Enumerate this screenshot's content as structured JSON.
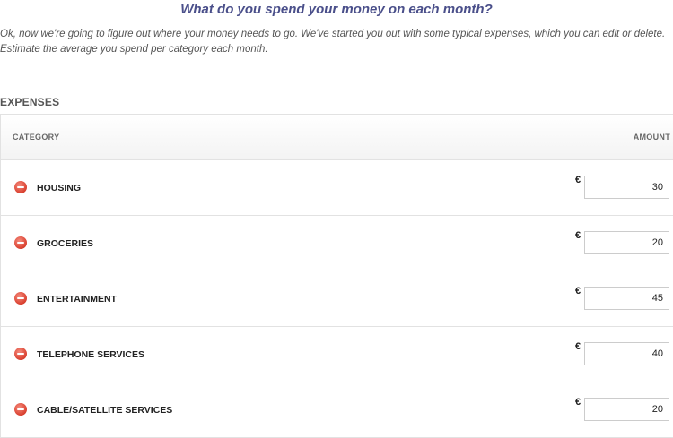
{
  "page": {
    "title": "What do you spend your money on each month?",
    "intro": "Ok, now we're going to figure out where your money needs to go. We've started you out with some typical expenses, which you can edit or delete. Estimate the average you spend per category each month."
  },
  "expenses": {
    "heading": "EXPENSES",
    "columns": {
      "category": "CATEGORY",
      "amount": "AMOUNT"
    },
    "currency_symbol": "€",
    "rows": [
      {
        "category": "HOUSING",
        "amount": "30"
      },
      {
        "category": "GROCERIES",
        "amount": "20"
      },
      {
        "category": "ENTERTAINMENT",
        "amount": "45"
      },
      {
        "category": "TELEPHONE SERVICES",
        "amount": "40"
      },
      {
        "category": "CABLE/SATELLITE SERVICES",
        "amount": "20"
      }
    ]
  },
  "colors": {
    "title": "#4a4f8a",
    "delete_icon": "#d9402f",
    "border": "#e2e2e2"
  },
  "icons": {
    "delete": "minus-circle-icon"
  }
}
